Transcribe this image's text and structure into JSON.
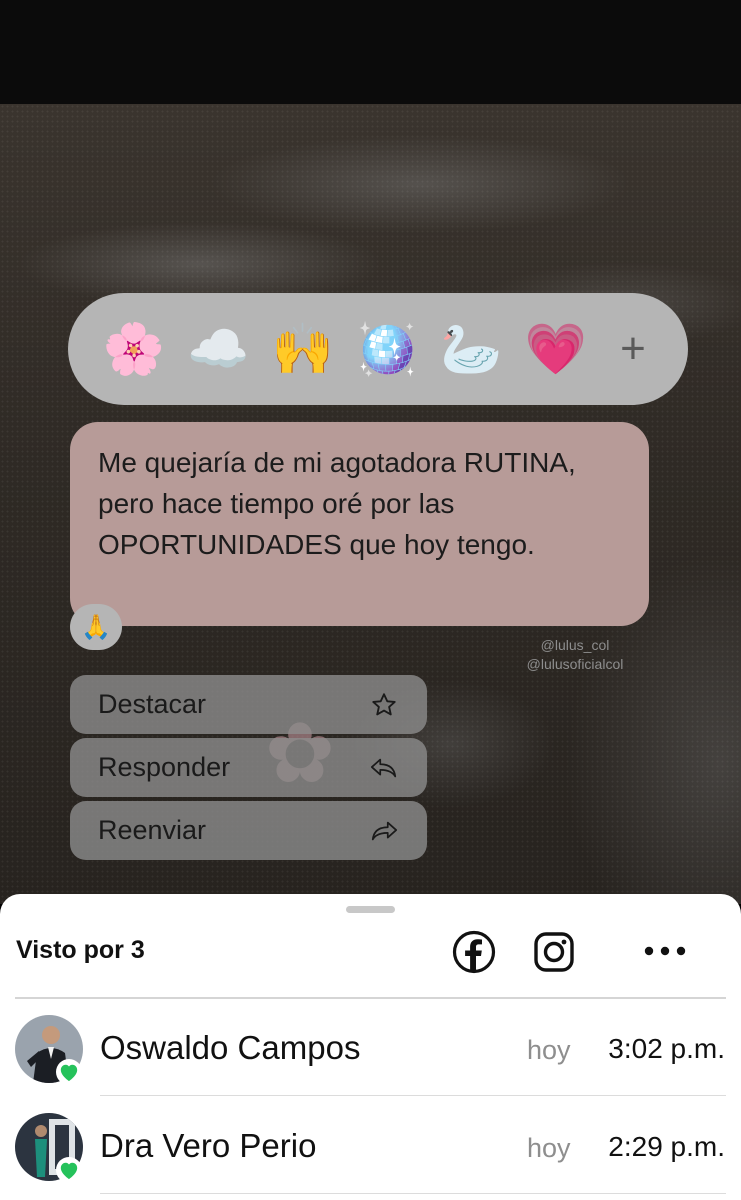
{
  "reactions": {
    "emojis": [
      "🌸",
      "☁️",
      "🙌",
      "🪩",
      "🦢",
      "💗"
    ],
    "add_label": "+"
  },
  "message": {
    "text": "Me quejaría de mi agotadora RUTINA, pero hace tiempo oré por las OPORTUNIDADES que hoy tengo.",
    "reaction": "🙏",
    "watermark_line1": "@lulus_col",
    "watermark_line2": "@lulusoficialcol"
  },
  "menu": {
    "items": [
      {
        "label": "Destacar",
        "icon": "star-icon"
      },
      {
        "label": "Responder",
        "icon": "reply-icon"
      },
      {
        "label": "Reenviar",
        "icon": "forward-icon"
      }
    ]
  },
  "sheet": {
    "seen_label": "Visto por 3",
    "share_icons": [
      "facebook-icon",
      "instagram-icon",
      "more-icon"
    ],
    "viewers": [
      {
        "name": "Oswaldo Campos",
        "day": "hoy",
        "time": "3:02 p.m.",
        "reaction": "💚"
      },
      {
        "name": "Dra Vero Perio",
        "day": "hoy",
        "time": "2:29 p.m.",
        "reaction": "💚"
      }
    ]
  },
  "colors": {
    "sheet_bg": "#ffffff",
    "bubble_bg": "#b79b98",
    "reaction_bar_bg": "#b5b5b5",
    "heart_green": "#25c25b"
  }
}
